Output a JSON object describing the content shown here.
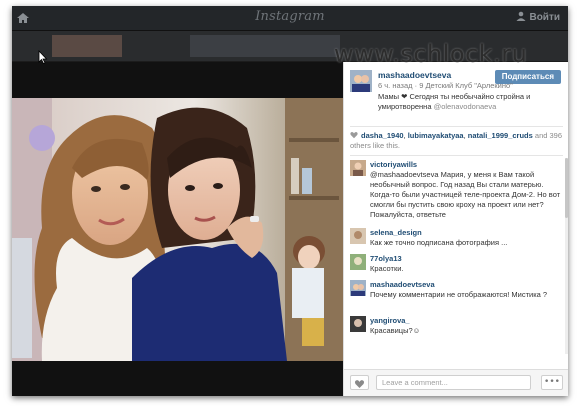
{
  "topbar": {
    "brand": "Instagram",
    "login_label": "Войти"
  },
  "watermark": "www.schlock.ru",
  "post": {
    "username": "mashaadoevtseva",
    "follow_label": "Подписаться",
    "meta": "6 ч. назад · 9 Детский Клуб \"Арлекино\"",
    "caption_text": "Мамы ❤ Сегодня ты необычайно стройна и умиротворенна",
    "caption_mention": "@olenavodonaeva"
  },
  "likes": {
    "users": [
      "dasha_1940",
      "lubimayakatyaa",
      "natali_1999_cruds"
    ],
    "and_label": "and",
    "others": "396",
    "tail": "others like this."
  },
  "comments": [
    {
      "user": "victoriyawills",
      "text": "@mashaadoevtseva Мария, у меня к Вам такой необычный вопрос. Год назад Вы стали матерью. Когда-то были участницей теле-проекта Дом-2. Но вот смогли бы пустить свою кроху на проект или нет? Пожалуйста, ответьте"
    },
    {
      "user": "selena_design",
      "text": "Как же точно подписана фотография ..."
    },
    {
      "user": "77olya13",
      "text": "Красотки."
    },
    {
      "user": "mashaadoevtseva",
      "text": "Почему комментарии не отображаются! Мистика ?"
    },
    {
      "user": "yangirova_",
      "text": "Красавицы?☺"
    }
  ],
  "footer": {
    "comment_placeholder": "Leave a comment...",
    "more_label": "•••"
  },
  "icons": {
    "home": "home-icon",
    "user": "user-icon",
    "heart": "heart-icon",
    "cursor": "cursor-icon"
  },
  "colors": {
    "brand_blue": "#1f4c73",
    "follow_button": "#5d8bb6",
    "topbar": "#232629"
  }
}
